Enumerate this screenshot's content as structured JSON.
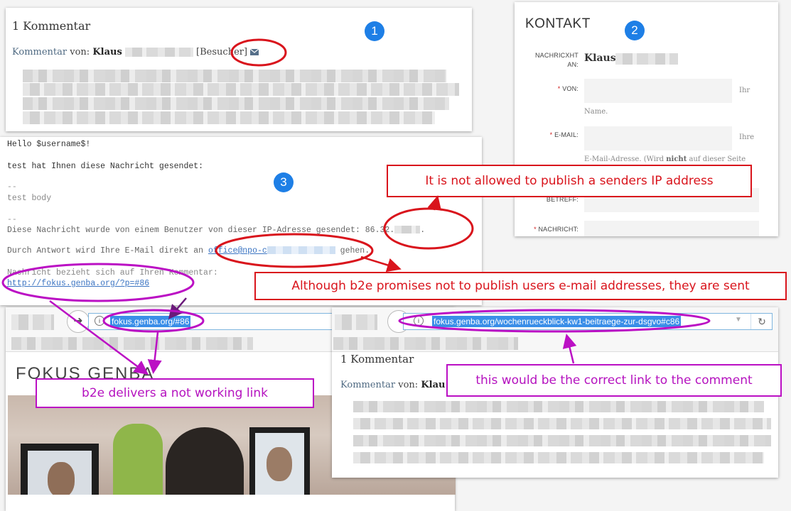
{
  "panel1": {
    "badge": "1",
    "title": "1 Kommentar",
    "comment_label": "Kommentar",
    "von_label": "von:",
    "author": "Klaus",
    "role": "[Besucher]",
    "mail_icon": "envelope-icon"
  },
  "panel2": {
    "badge": "2",
    "title": "KONTAKT",
    "fields": [
      {
        "label_line1": "NACHRICXHT",
        "label_line2": "AN:",
        "value": "Klaus"
      },
      {
        "required": "*",
        "label": "VON:",
        "hint_right": "Ihr",
        "hint_below": "Name."
      },
      {
        "required": "*",
        "label": "E-MAIL:",
        "hint_right": "Ihre",
        "hint_below_pre": "E-Mail-Adresse. (Wird ",
        "hint_below_bold": "nicht",
        "hint_below_post": " auf dieser Seite"
      },
      {
        "label": "BETREFF:"
      },
      {
        "required": "*",
        "label": "NACHRICHT:"
      }
    ]
  },
  "panel3": {
    "badge": "3",
    "lines": {
      "greeting": "Hello $username$!",
      "sent": "test hat Ihnen diese Nachricht gesendet:",
      "sep1": "--",
      "body": "test body",
      "sep2": "--",
      "ip_line": "Diese Nachricht wurde von einem Benutzer von dieser IP-Adresse gesendet: 86.32.",
      "ip_end": ".",
      "reply_pre": "Durch Antwort wird Ihre E-Mail direkt an ",
      "reply_email": "office@npo-c",
      "reply_post": " gehen.",
      "ref_line": "Nachricht bezieht sich auf Ihren Kommentar:",
      "ref_link": "http://fokus.genba.org/?p=#86"
    }
  },
  "browser_left": {
    "url": "fokus.genba.org/#86",
    "site_title": "FOKUS GENBA"
  },
  "browser_right": {
    "url": "fokus.genba.org/wochenrueckblick-kw1-beitraege-zur-dsgvo#c86",
    "comment_count": "1 Kommentar",
    "comment_label": "Kommentar",
    "von_label": "von:",
    "author": "Klau"
  },
  "callouts": {
    "ip": "It is not allowed to publish a senders IP address",
    "email": "Although b2e promises not to publish users e-mail addresses, they are sent",
    "bad_link": "b2e delivers a not working link",
    "correct_link": "this would be the correct link to the comment"
  },
  "colors": {
    "annotation_red": "#d9141c",
    "annotation_purple": "#bb10c4",
    "badge_blue": "#1e7fe6",
    "link_blue": "#3b74c2",
    "url_selection": "#3a8ee8"
  }
}
